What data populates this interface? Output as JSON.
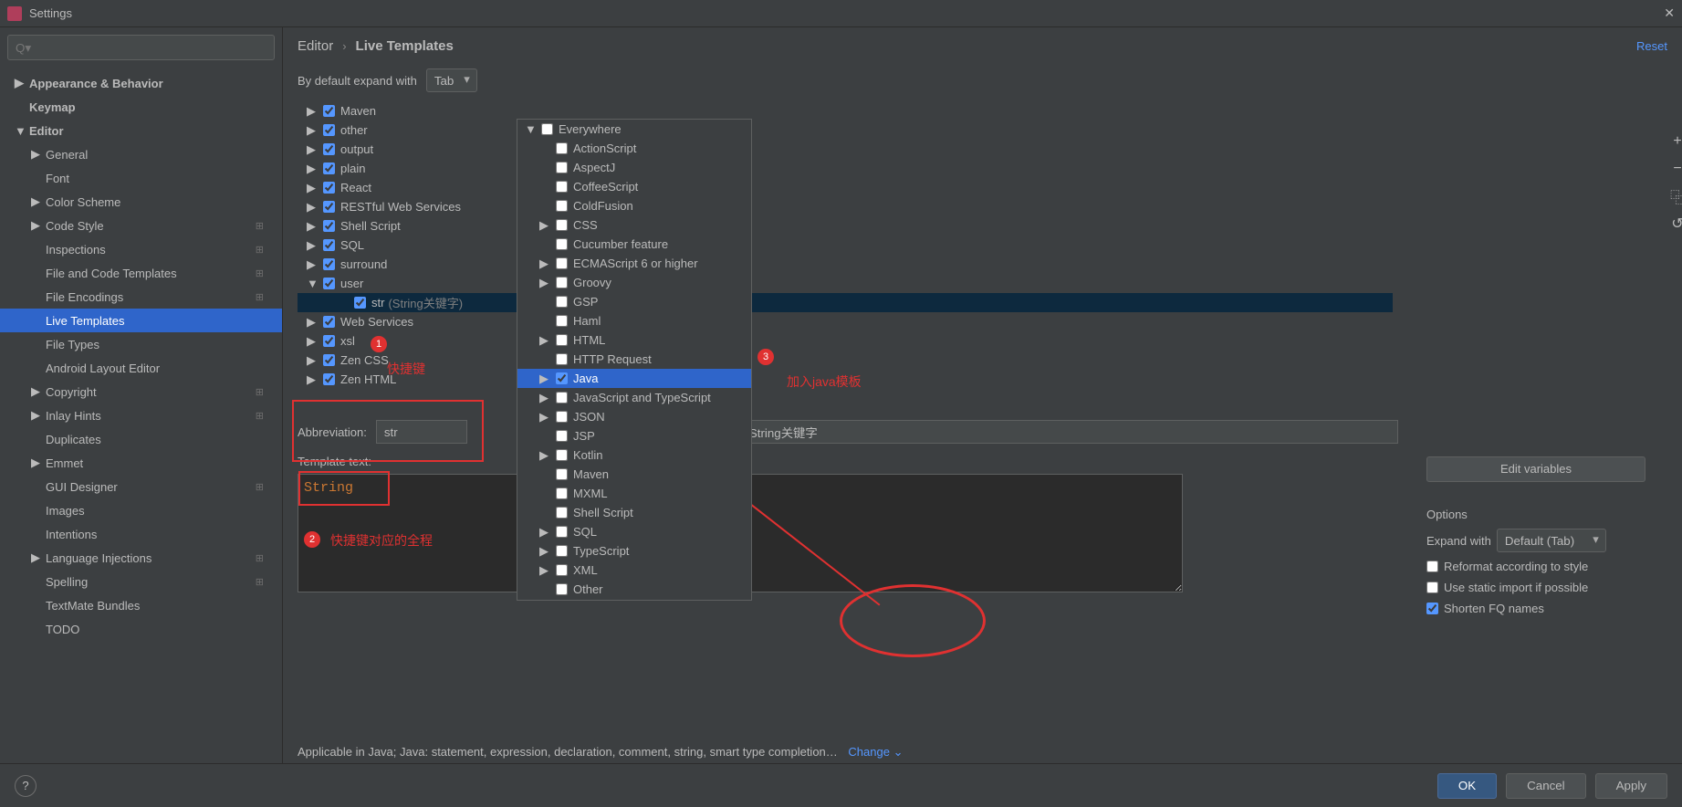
{
  "window": {
    "title": "Settings"
  },
  "search": {
    "placeholder": "Q▾"
  },
  "breadcrumb": {
    "a": "Editor",
    "b": "Live Templates"
  },
  "reset_label": "Reset",
  "expand": {
    "label": "By default expand with",
    "value": "Tab"
  },
  "sidebar": {
    "items": [
      {
        "label": "Appearance & Behavior",
        "lvl": 0,
        "arrow": "▶"
      },
      {
        "label": "Keymap",
        "lvl": 0,
        "arrow": ""
      },
      {
        "label": "Editor",
        "lvl": 0,
        "arrow": "▼"
      },
      {
        "label": "General",
        "lvl": 1,
        "arrow": "▶"
      },
      {
        "label": "Font",
        "lvl": 1,
        "arrow": ""
      },
      {
        "label": "Color Scheme",
        "lvl": 1,
        "arrow": "▶"
      },
      {
        "label": "Code Style",
        "lvl": 1,
        "arrow": "▶",
        "badge": "⊞"
      },
      {
        "label": "Inspections",
        "lvl": 1,
        "arrow": "",
        "badge": "⊞"
      },
      {
        "label": "File and Code Templates",
        "lvl": 1,
        "arrow": "",
        "badge": "⊞"
      },
      {
        "label": "File Encodings",
        "lvl": 1,
        "arrow": "",
        "badge": "⊞"
      },
      {
        "label": "Live Templates",
        "lvl": 1,
        "arrow": "",
        "selected": true
      },
      {
        "label": "File Types",
        "lvl": 1,
        "arrow": ""
      },
      {
        "label": "Android Layout Editor",
        "lvl": 1,
        "arrow": ""
      },
      {
        "label": "Copyright",
        "lvl": 1,
        "arrow": "▶",
        "badge": "⊞"
      },
      {
        "label": "Inlay Hints",
        "lvl": 1,
        "arrow": "▶",
        "badge": "⊞"
      },
      {
        "label": "Duplicates",
        "lvl": 1,
        "arrow": ""
      },
      {
        "label": "Emmet",
        "lvl": 1,
        "arrow": "▶"
      },
      {
        "label": "GUI Designer",
        "lvl": 1,
        "arrow": "",
        "badge": "⊞"
      },
      {
        "label": "Images",
        "lvl": 1,
        "arrow": ""
      },
      {
        "label": "Intentions",
        "lvl": 1,
        "arrow": ""
      },
      {
        "label": "Language Injections",
        "lvl": 1,
        "arrow": "▶",
        "badge": "⊞"
      },
      {
        "label": "Spelling",
        "lvl": 1,
        "arrow": "",
        "badge": "⊞"
      },
      {
        "label": "TextMate Bundles",
        "lvl": 1,
        "arrow": ""
      },
      {
        "label": "TODO",
        "lvl": 1,
        "arrow": ""
      }
    ]
  },
  "templates": [
    {
      "label": "Maven",
      "arrow": "▶",
      "checked": true
    },
    {
      "label": "other",
      "arrow": "▶",
      "checked": true
    },
    {
      "label": "output",
      "arrow": "▶",
      "checked": true
    },
    {
      "label": "plain",
      "arrow": "▶",
      "checked": true
    },
    {
      "label": "React",
      "arrow": "▶",
      "checked": true
    },
    {
      "label": "RESTful Web Services",
      "arrow": "▶",
      "checked": true
    },
    {
      "label": "Shell Script",
      "arrow": "▶",
      "checked": true
    },
    {
      "label": "SQL",
      "arrow": "▶",
      "checked": true
    },
    {
      "label": "surround",
      "arrow": "▶",
      "checked": true
    },
    {
      "label": "user",
      "arrow": "▼",
      "checked": true
    },
    {
      "label": "str",
      "suffix": "(String关键字)",
      "arrow": "",
      "checked": true,
      "child": true,
      "selected": true
    },
    {
      "label": "Web Services",
      "arrow": "▶",
      "checked": true
    },
    {
      "label": "xsl",
      "arrow": "▶",
      "checked": true
    },
    {
      "label": "Zen CSS",
      "arrow": "▶",
      "checked": true
    },
    {
      "label": "Zen HTML",
      "arrow": "▶",
      "checked": true
    }
  ],
  "popup": {
    "root": "Everywhere",
    "items": [
      {
        "label": "ActionScript",
        "arrow": "",
        "checked": false
      },
      {
        "label": "AspectJ",
        "arrow": "",
        "checked": false
      },
      {
        "label": "CoffeeScript",
        "arrow": "",
        "checked": false
      },
      {
        "label": "ColdFusion",
        "arrow": "",
        "checked": false
      },
      {
        "label": "CSS",
        "arrow": "▶",
        "checked": false
      },
      {
        "label": "Cucumber feature",
        "arrow": "",
        "checked": false
      },
      {
        "label": "ECMAScript 6 or higher",
        "arrow": "▶",
        "checked": false
      },
      {
        "label": "Groovy",
        "arrow": "▶",
        "checked": false
      },
      {
        "label": "GSP",
        "arrow": "",
        "checked": false
      },
      {
        "label": "Haml",
        "arrow": "",
        "checked": false
      },
      {
        "label": "HTML",
        "arrow": "▶",
        "checked": false
      },
      {
        "label": "HTTP Request",
        "arrow": "",
        "checked": false
      },
      {
        "label": "Java",
        "arrow": "▶",
        "checked": true,
        "selected": true
      },
      {
        "label": "JavaScript and TypeScript",
        "arrow": "▶",
        "checked": false
      },
      {
        "label": "JSON",
        "arrow": "▶",
        "checked": false
      },
      {
        "label": "JSP",
        "arrow": "",
        "checked": false
      },
      {
        "label": "Kotlin",
        "arrow": "▶",
        "checked": false
      },
      {
        "label": "Maven",
        "arrow": "",
        "checked": false
      },
      {
        "label": "MXML",
        "arrow": "",
        "checked": false
      },
      {
        "label": "Shell Script",
        "arrow": "",
        "checked": false
      },
      {
        "label": "SQL",
        "arrow": "▶",
        "checked": false
      },
      {
        "label": "TypeScript",
        "arrow": "▶",
        "checked": false
      },
      {
        "label": "XML",
        "arrow": "▶",
        "checked": false
      },
      {
        "label": "Other",
        "arrow": "",
        "checked": false
      }
    ]
  },
  "form": {
    "abbr_label": "Abbreviation:",
    "abbr_value": "str",
    "desc_value": "String关键字",
    "tpl_label": "Template text:",
    "tpl_value": "String"
  },
  "annotations": {
    "b1": "1",
    "b2": "2",
    "b3": "3",
    "t1": "快捷键",
    "t2": "快捷键对应的全程",
    "t3": "加入java模板"
  },
  "right": {
    "edit_vars": "Edit variables",
    "options": "Options",
    "expand_with": "Expand with",
    "expand_val": "Default (Tab)",
    "reformat": "Reformat according to style",
    "static_import": "Use static import if possible",
    "shorten": "Shorten FQ names"
  },
  "applicable": {
    "text": "Applicable in Java; Java: statement, expression, declaration, comment, string, smart type completion…",
    "change": "Change"
  },
  "side_btns": {
    "add": "+",
    "remove": "−",
    "copy": "⿻",
    "restore": "↺"
  },
  "footer": {
    "ok": "OK",
    "cancel": "Cancel",
    "apply": "Apply",
    "help": "?"
  }
}
